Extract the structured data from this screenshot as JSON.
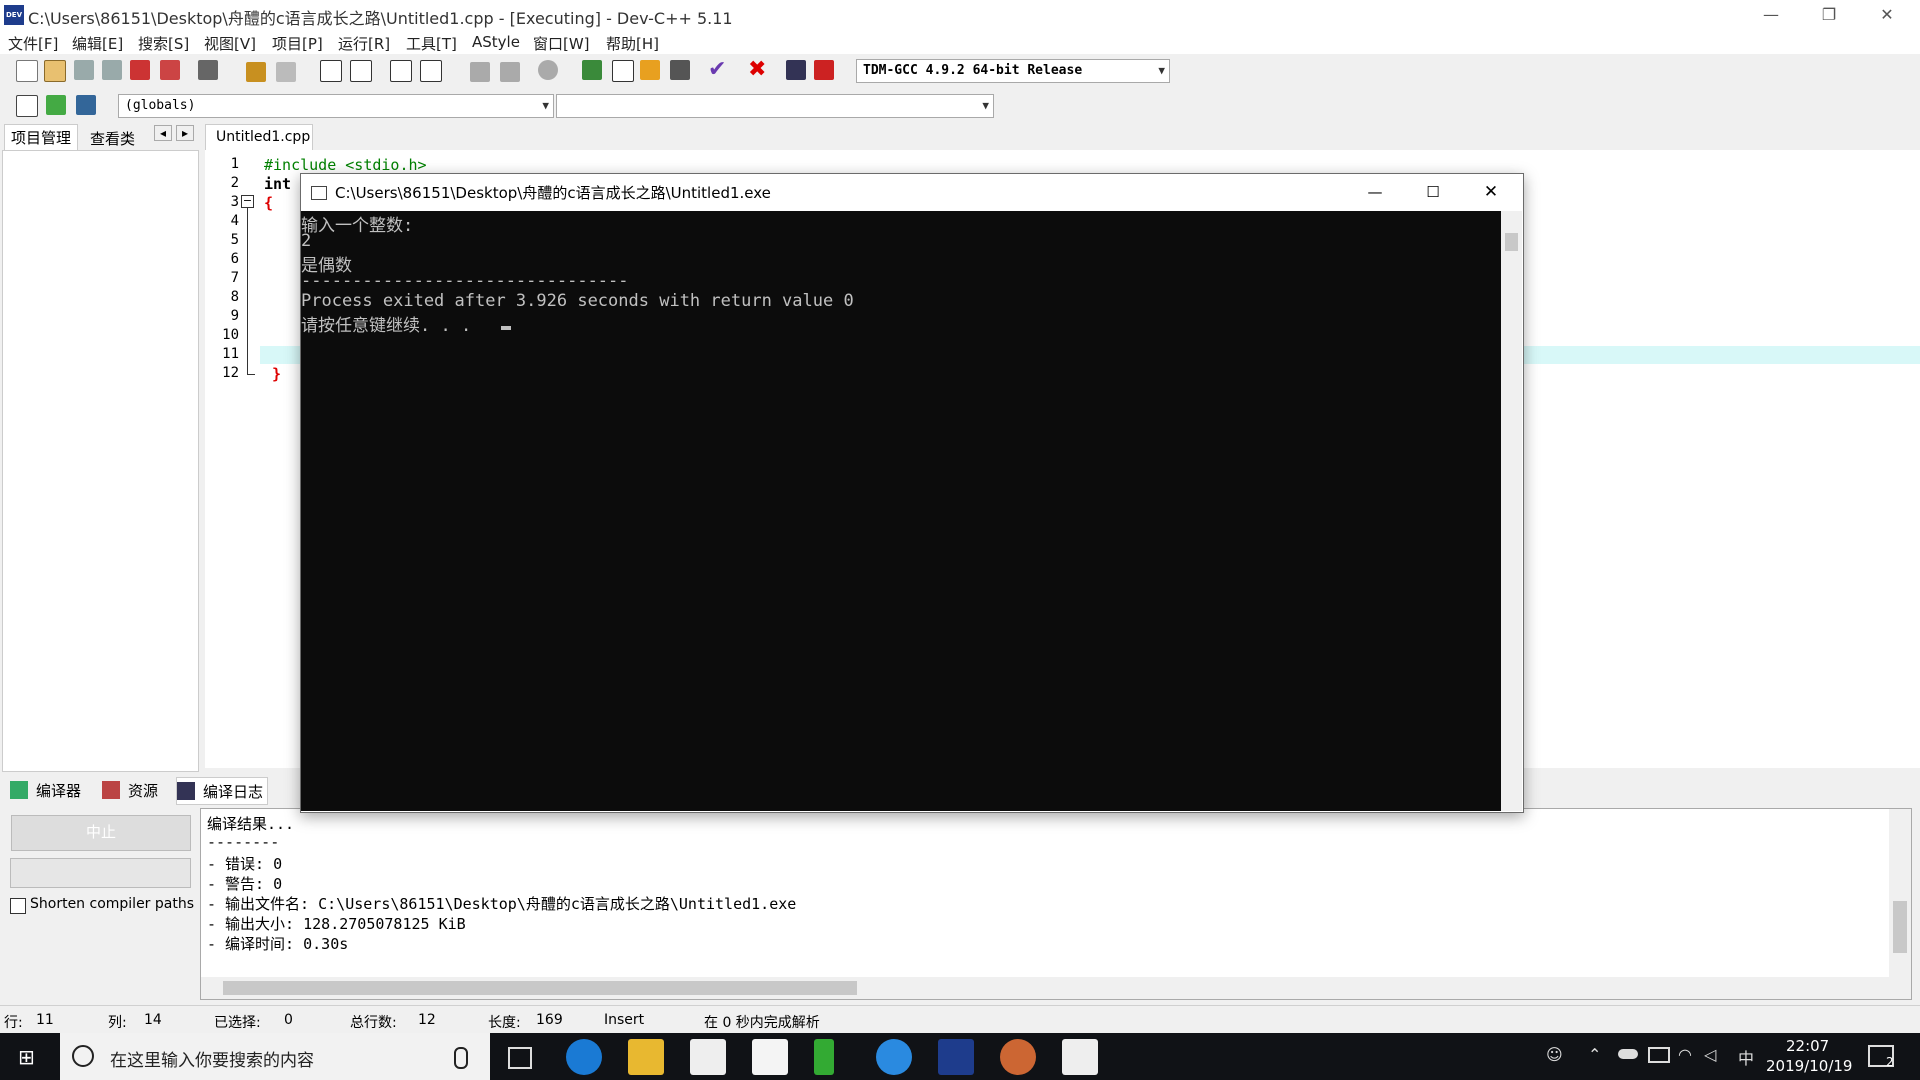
{
  "window": {
    "title": "C:\\Users\\86151\\Desktop\\舟醴的c语言成长之路\\Untitled1.cpp - [Executing] - Dev-C++ 5.11",
    "app_icon_text": "DEV",
    "minimize": "—",
    "restore": "❐",
    "close": "✕"
  },
  "menu": [
    "文件[F]",
    "编辑[E]",
    "搜索[S]",
    "视图[V]",
    "项目[P]",
    "运行[R]",
    "工具[T]",
    "AStyle",
    "窗口[W]",
    "帮助[H]"
  ],
  "toolbar": {
    "compiler_select": "TDM-GCC 4.9.2 64-bit Release",
    "scope_select": "(globals)",
    "function_select": ""
  },
  "left_panel": {
    "tab_project": "项目管理",
    "tab_classes": "查看类",
    "nav_prev": "◂",
    "nav_next": "▸"
  },
  "editor": {
    "file_tab": "Untitled1.cpp",
    "line_numbers": [
      "1",
      "2",
      "3",
      "4",
      "5",
      "6",
      "7",
      "8",
      "9",
      "10",
      "11",
      "12"
    ],
    "code_line1": "#include <stdio.h>",
    "code_line2": "int",
    "code_line3": "{",
    "code_line12": "}",
    "fold_marker": "−"
  },
  "console": {
    "title": "C:\\Users\\86151\\Desktop\\舟醴的c语言成长之路\\Untitled1.exe",
    "lines": [
      "输入一个整数:",
      "2",
      "是偶数",
      "--------------------------------",
      "Process exited after 3.926 seconds with return value 0",
      "请按任意键继续. . . "
    ],
    "minimize": "—",
    "maximize": "☐",
    "close": "✕"
  },
  "bottom_tabs": {
    "compiler": "编译器",
    "resources": "资源",
    "compile_log": "编译日志"
  },
  "bottom_left": {
    "abort_button": "中止",
    "shorten_paths_label": "Shorten compiler paths"
  },
  "compile_log": [
    "编译结果...",
    "--------",
    "- 错误: 0",
    "- 警告: 0",
    "- 输出文件名: C:\\Users\\86151\\Desktop\\舟醴的c语言成长之路\\Untitled1.exe",
    "- 输出大小: 128.2705078125 KiB",
    "- 编译时间: 0.30s"
  ],
  "statusbar": {
    "row_label": "行:",
    "row_value": "11",
    "col_label": "列:",
    "col_value": "14",
    "selected_label": "已选择:",
    "selected_value": "0",
    "total_label": "总行数:",
    "total_value": "12",
    "length_label": "长度:",
    "length_value": "169",
    "mode": "Insert",
    "parse_info": "在 0 秒内完成解析"
  },
  "taskbar": {
    "search_placeholder": "在这里输入你要搜索的内容",
    "time": "22:07",
    "date": "2019/10/19",
    "ime": "中",
    "notification_count": "2"
  }
}
